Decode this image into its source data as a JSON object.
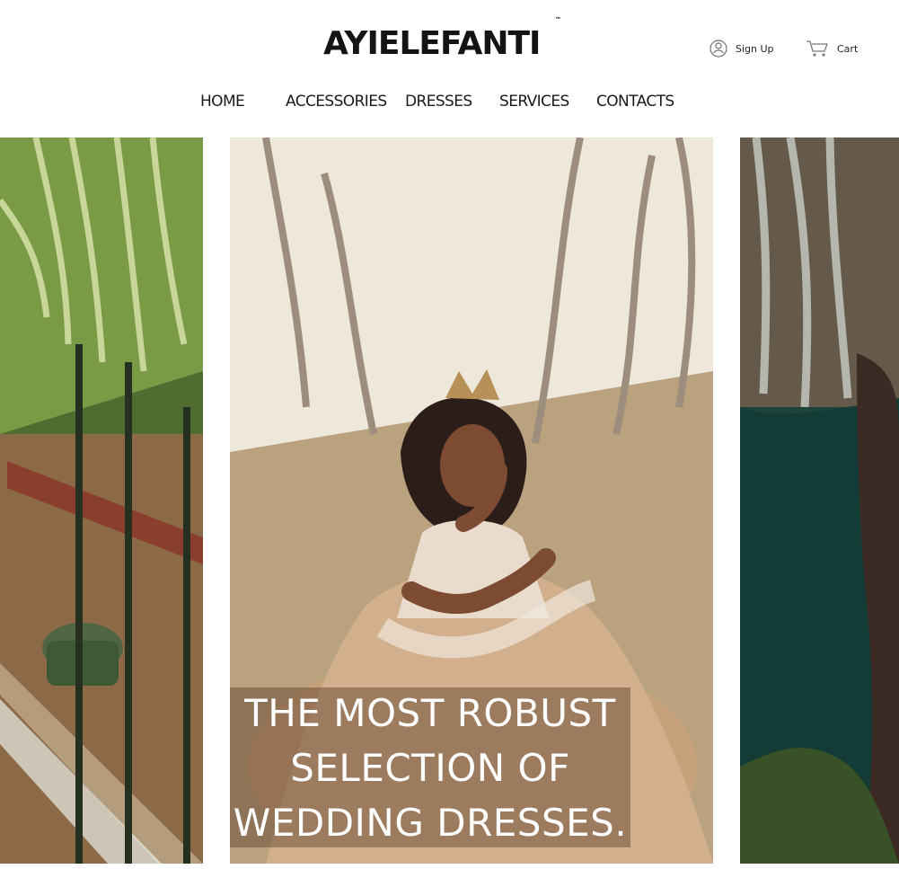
{
  "brand": {
    "name": "AYIELEFANTI",
    "tm": "™"
  },
  "account": {
    "signup_label": "Sign Up",
    "cart_label": "Cart",
    "signup_icon": "user-icon",
    "cart_icon": "shopping-cart-icon"
  },
  "nav": {
    "items": [
      {
        "label": "HOME"
      },
      {
        "label": "ACCESSORIES"
      },
      {
        "label": "DRESSES"
      },
      {
        "label": "SERVICES"
      },
      {
        "label": "CONTACTS"
      }
    ]
  },
  "gallery": {
    "caption_lines": [
      "THE MOST ROBUST",
      "SELECTION OF",
      "WEDDING DRESSES."
    ]
  },
  "colors": {
    "text": "#141414",
    "caption_overlay": "#5c3e28"
  }
}
